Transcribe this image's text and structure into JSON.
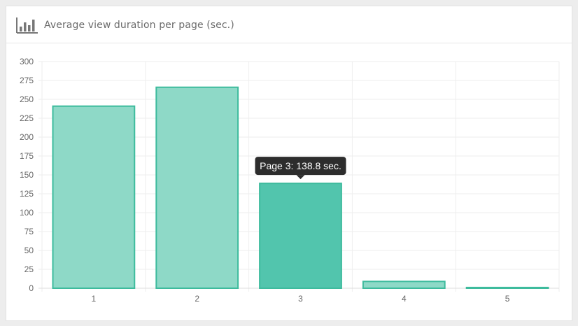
{
  "header": {
    "title": "Average view duration per page (sec.)",
    "icon": "bar-chart-icon"
  },
  "chart_data": {
    "type": "bar",
    "categories": [
      "1",
      "2",
      "3",
      "4",
      "5"
    ],
    "values": [
      241,
      266,
      138.8,
      9,
      1
    ],
    "ylim": [
      0,
      300
    ],
    "yticks": [
      "0",
      "25",
      "50",
      "75",
      "100",
      "125",
      "150",
      "175",
      "200",
      "225",
      "250",
      "275",
      "300"
    ],
    "grid": true,
    "highlighted_index": 2,
    "tooltip": "Page 3: 138.8 sec.",
    "colors": {
      "bar_fill": "#8ed9c7",
      "bar_fill_active": "#52c5ad",
      "bar_stroke": "#3dbb9d",
      "grid": "#eeeeee",
      "axis_text": "#666666",
      "tooltip_bg": "#2d2d2d",
      "tooltip_text": "#ffffff"
    }
  }
}
